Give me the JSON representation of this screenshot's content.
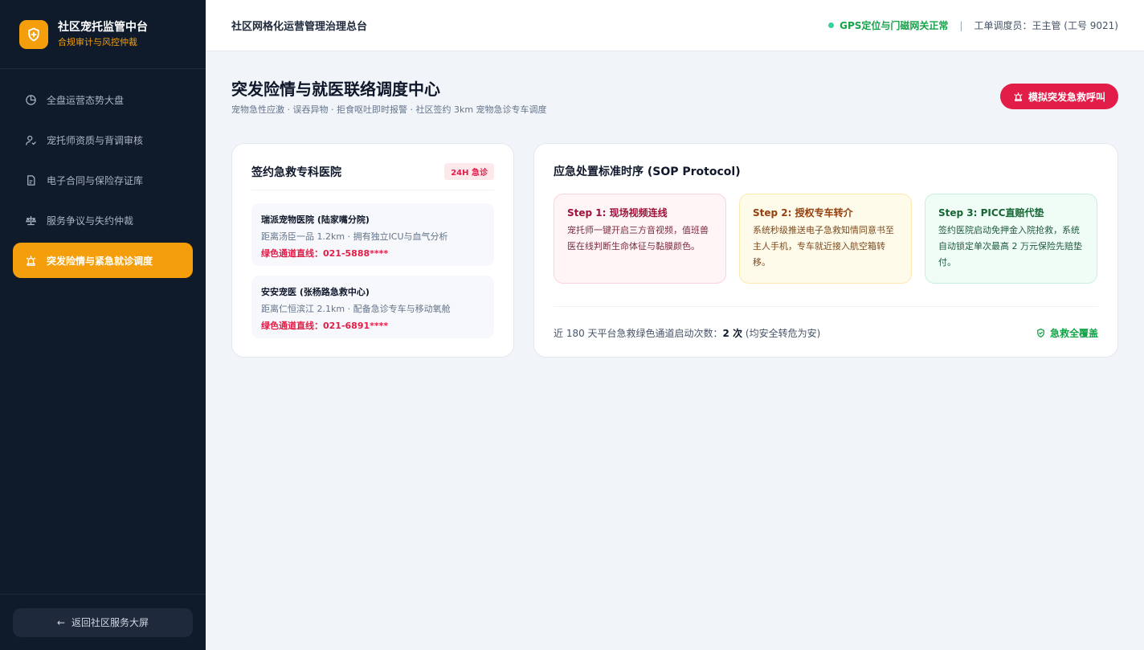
{
  "brand": {
    "title": "社区宠托监管中台",
    "subtitle": "合规审计与风控仲裁"
  },
  "sidebar": {
    "items": [
      {
        "label": "全盘运营态势大盘",
        "icon": "pie-chart-icon",
        "active": false
      },
      {
        "label": "宠托师资质与背调审核",
        "icon": "user-check-icon",
        "active": false
      },
      {
        "label": "电子合同与保险存证库",
        "icon": "document-icon",
        "active": false
      },
      {
        "label": "服务争议与失约仲裁",
        "icon": "scales-icon",
        "active": false
      },
      {
        "label": "突发险情与紧急就诊调度",
        "icon": "siren-icon",
        "active": true
      }
    ],
    "back_label": "返回社区服务大屏"
  },
  "header": {
    "title": "社区网格化运营管理治理总台",
    "gps_status": "GPS定位与门磁网关正常",
    "separator": "|",
    "dispatcher": "工单调度员：王主管 (工号 9021)"
  },
  "page": {
    "title": "突发险情与就医联络调度中心",
    "subtitle": "宠物急性应激 · 误吞异物 · 拒食呕吐即时报警 · 社区签约 3km 宠物急诊专车调度",
    "sos_label": "模拟突发急救呼叫"
  },
  "hospitals": {
    "title": "签约急救专科医院",
    "badge": "24H 急诊",
    "items": [
      {
        "name": "瑞派宠物医院 (陆家嘴分院)",
        "desc": "距离汤臣一品 1.2km · 拥有独立ICU与血气分析",
        "line": "绿色通道直线：021-5888****"
      },
      {
        "name": "安安宠医 (张杨路急救中心)",
        "desc": "距离仁恒滨江 2.1km · 配备急诊专车与移动氧舱",
        "line": "绿色通道直线：021-6891****"
      }
    ]
  },
  "sop": {
    "title": "应急处置标准时序 (SOP Protocol)",
    "steps": [
      {
        "title": "Step 1: 现场视频连线",
        "desc": "宠托师一键开启三方音视频，值班兽医在线判断生命体征与黏膜颜色。"
      },
      {
        "title": "Step 2: 授权专车转介",
        "desc": "系统秒级推送电子急救知情同意书至主人手机，专车就近接入航空箱转移。"
      },
      {
        "title": "Step 3: PICC直赔代垫",
        "desc": "签约医院启动免押金入院抢救，系统自动锁定单次最高 2 万元保险先赔垫付。"
      }
    ],
    "footer_prefix": "近 180 天平台急救绿色通道启动次数：",
    "footer_count": "2 次",
    "footer_suffix": " (均安全转危为安)",
    "covered_label": "急救全覆盖"
  },
  "colors": {
    "sidebar_bg": "#0f1a2b",
    "accent": "#f59e0b",
    "danger": "#e11d48",
    "ok": "#16a34a"
  }
}
